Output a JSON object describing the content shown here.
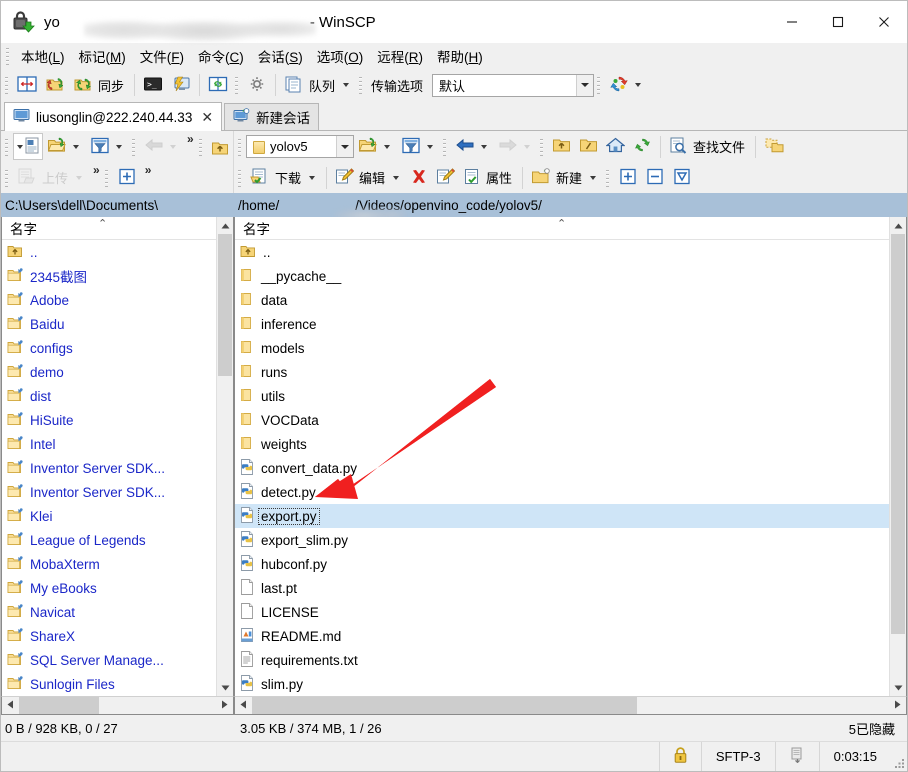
{
  "window": {
    "title_prefix": "yo",
    "title_suffix": " - WinSCP",
    "redacted_placeholder": "",
    "minimize": "—",
    "maximize": "☐",
    "close": "✕"
  },
  "menubar": {
    "items": [
      {
        "name": "local",
        "pre": "本地",
        "key": "L",
        "post": ""
      },
      {
        "name": "mark",
        "pre": "标记",
        "key": "M",
        "post": ""
      },
      {
        "name": "files",
        "pre": "文件",
        "key": "F",
        "post": ""
      },
      {
        "name": "commands",
        "pre": "命令",
        "key": "C",
        "post": ""
      },
      {
        "name": "session",
        "pre": "会话",
        "key": "S",
        "post": ""
      },
      {
        "name": "options",
        "pre": "选项",
        "key": "O",
        "post": ""
      },
      {
        "name": "remote",
        "pre": "远程",
        "key": "R",
        "post": ""
      },
      {
        "name": "help",
        "pre": "帮助",
        "key": "H",
        "post": ""
      }
    ]
  },
  "toolbar": {
    "sync_label": "同步",
    "queue_label": "队列",
    "transfer_options_label": "传输选项",
    "transfer_preset_value": "默认"
  },
  "tabs": {
    "session_tab": "liusonglin@222.240.44.33",
    "close_glyph": "✕",
    "new_session": "新建会话"
  },
  "remote_toolbar": {
    "path_combo_value": "yolov5",
    "find_files_label": "查找文件",
    "download_label": "下载",
    "edit_label": "编辑",
    "properties_label": "属性",
    "new_label": "新建"
  },
  "local_toolbar": {
    "upload_label": "上传",
    "chevron": "»"
  },
  "local_panel": {
    "path": "C:\\Users\\dell\\Documents\\",
    "column_header": "名字",
    "sort_indicator": "⌃",
    "status": "0 B / 928 KB,  0 / 27",
    "items": [
      {
        "name": "..",
        "icon": "up-folder-icon",
        "kind": "parent"
      },
      {
        "name": "2345截图",
        "icon": "folder-shortcut-icon",
        "kind": "folder"
      },
      {
        "name": "Adobe",
        "icon": "folder-shortcut-icon",
        "kind": "folder"
      },
      {
        "name": "Baidu",
        "icon": "folder-shortcut-icon",
        "kind": "folder"
      },
      {
        "name": "configs",
        "icon": "folder-shortcut-icon",
        "kind": "folder"
      },
      {
        "name": "demo",
        "icon": "folder-shortcut-icon",
        "kind": "folder"
      },
      {
        "name": "dist",
        "icon": "folder-shortcut-icon",
        "kind": "folder"
      },
      {
        "name": "HiSuite",
        "icon": "folder-shortcut-icon",
        "kind": "folder"
      },
      {
        "name": "Intel",
        "icon": "folder-shortcut-icon",
        "kind": "folder"
      },
      {
        "name": "Inventor Server SDK...",
        "icon": "folder-shortcut-icon",
        "kind": "folder"
      },
      {
        "name": "Inventor Server SDK...",
        "icon": "folder-shortcut-icon",
        "kind": "folder"
      },
      {
        "name": "Klei",
        "icon": "folder-shortcut-icon",
        "kind": "folder"
      },
      {
        "name": "League of Legends",
        "icon": "folder-shortcut-icon",
        "kind": "folder"
      },
      {
        "name": "MobaXterm",
        "icon": "folder-shortcut-icon",
        "kind": "folder"
      },
      {
        "name": "My eBooks",
        "icon": "folder-shortcut-icon",
        "kind": "folder"
      },
      {
        "name": "Navicat",
        "icon": "folder-shortcut-icon",
        "kind": "folder"
      },
      {
        "name": "ShareX",
        "icon": "folder-shortcut-icon",
        "kind": "folder"
      },
      {
        "name": "SQL Server Manage...",
        "icon": "folder-shortcut-icon",
        "kind": "folder"
      },
      {
        "name": "Sunlogin Files",
        "icon": "folder-shortcut-icon",
        "kind": "folder"
      }
    ]
  },
  "remote_panel": {
    "path_prefix": "/home/",
    "path_suffix": "/Videos/openvino_code/yolov5/",
    "column_header": "名字",
    "sort_indicator": "⌃",
    "status": "3.05 KB / 374 MB,  1 / 26",
    "hidden_status": "5已隐藏",
    "items": [
      {
        "name": "..",
        "icon": "up-folder-icon",
        "kind": "parent",
        "selected": false
      },
      {
        "name": "__pycache__",
        "icon": "folder-icon",
        "kind": "folder",
        "selected": false
      },
      {
        "name": "data",
        "icon": "folder-icon",
        "kind": "folder",
        "selected": false
      },
      {
        "name": "inference",
        "icon": "folder-icon",
        "kind": "folder",
        "selected": false
      },
      {
        "name": "models",
        "icon": "folder-icon",
        "kind": "folder",
        "selected": false
      },
      {
        "name": "runs",
        "icon": "folder-icon",
        "kind": "folder",
        "selected": false
      },
      {
        "name": "utils",
        "icon": "folder-icon",
        "kind": "folder",
        "selected": false
      },
      {
        "name": "VOCData",
        "icon": "folder-icon",
        "kind": "folder",
        "selected": false
      },
      {
        "name": "weights",
        "icon": "folder-icon",
        "kind": "folder",
        "selected": false
      },
      {
        "name": "convert_data.py",
        "icon": "python-file-icon",
        "kind": "file",
        "selected": false
      },
      {
        "name": "detect.py",
        "icon": "python-file-icon",
        "kind": "file",
        "selected": false
      },
      {
        "name": "export.py",
        "icon": "python-file-icon",
        "kind": "file",
        "selected": true
      },
      {
        "name": "export_slim.py",
        "icon": "python-file-icon",
        "kind": "file",
        "selected": false
      },
      {
        "name": "hubconf.py",
        "icon": "python-file-icon",
        "kind": "file",
        "selected": false
      },
      {
        "name": "last.pt",
        "icon": "blank-file-icon",
        "kind": "file",
        "selected": false
      },
      {
        "name": "LICENSE",
        "icon": "blank-file-icon",
        "kind": "file",
        "selected": false
      },
      {
        "name": "README.md",
        "icon": "markdown-file-icon",
        "kind": "file",
        "selected": false
      },
      {
        "name": "requirements.txt",
        "icon": "text-file-icon",
        "kind": "file",
        "selected": false
      },
      {
        "name": "slim.py",
        "icon": "python-file-icon",
        "kind": "file",
        "selected": false
      }
    ]
  },
  "statusbar": {
    "lock_icon": "lock-icon",
    "protocol": "SFTP-3",
    "transfer_icon": "transfer-icon",
    "elapsed": "0:03:15"
  },
  "annotation": {
    "arrow_color": "#f02020",
    "points_to": "export.py"
  }
}
